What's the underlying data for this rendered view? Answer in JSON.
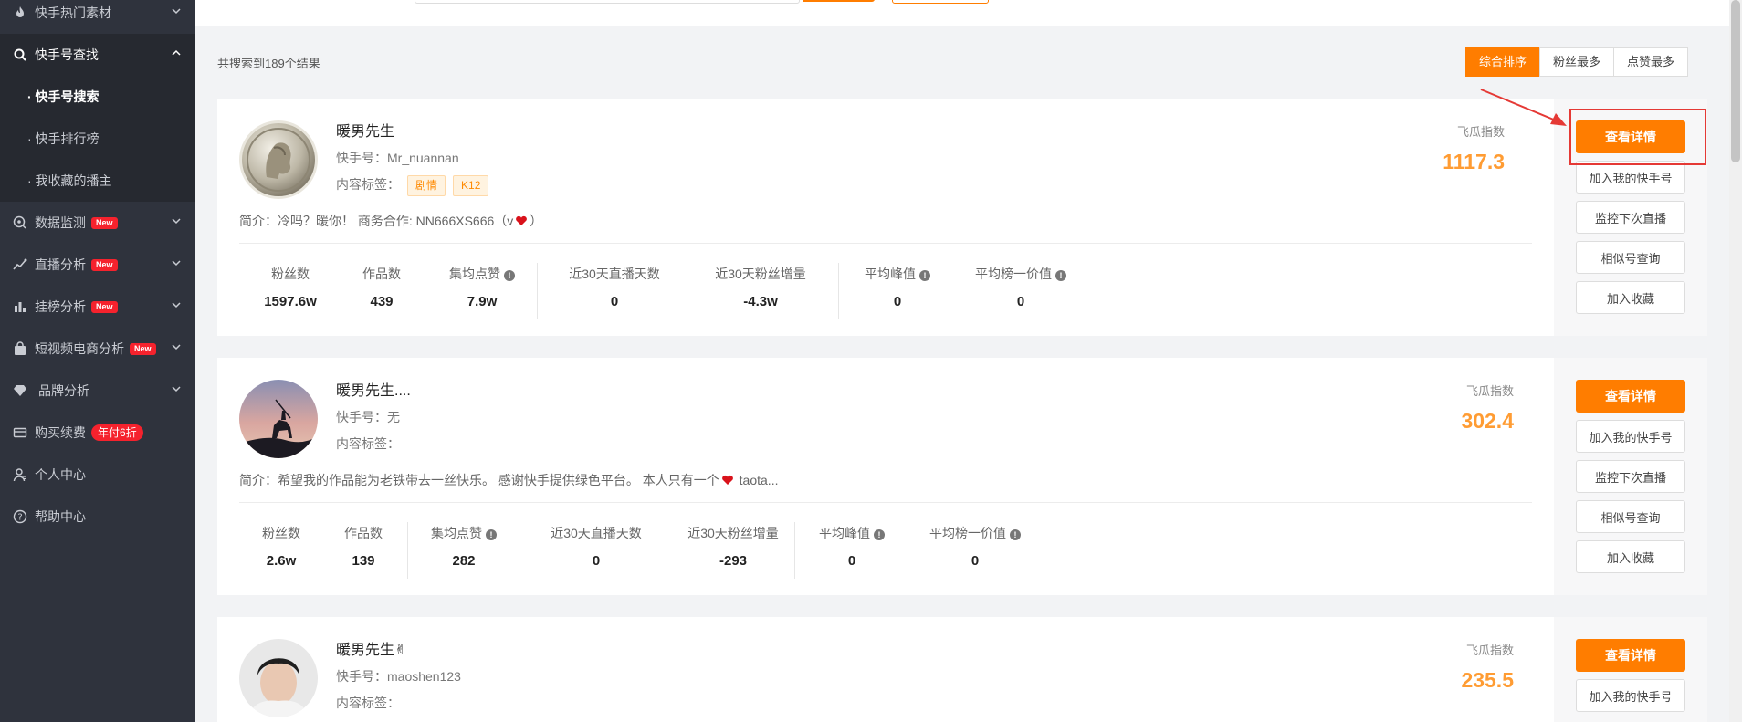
{
  "sidebar": {
    "items": [
      {
        "label": "快手热门素材",
        "icon": "fire-icon"
      },
      {
        "label": "快手号查找",
        "icon": "search-icon"
      },
      {
        "label": "· 快手号搜索"
      },
      {
        "label": "· 快手排行榜"
      },
      {
        "label": "· 我收藏的播主"
      },
      {
        "label": "数据监测",
        "icon": "monitor-icon",
        "badge": "New"
      },
      {
        "label": "直播分析",
        "icon": "trend-icon",
        "badge": "New"
      },
      {
        "label": "挂榜分析",
        "icon": "bar-chart-icon",
        "badge": "New"
      },
      {
        "label": "短视频电商分析",
        "icon": "shopping-bag-icon",
        "badge": "New"
      },
      {
        "label": "品牌分析",
        "icon": "diamond-icon"
      },
      {
        "label": "购买续费",
        "icon": "card-icon",
        "badge": "年付6折"
      },
      {
        "label": "个人中心",
        "icon": "user-icon"
      },
      {
        "label": "帮助中心",
        "icon": "help-icon"
      }
    ]
  },
  "results": {
    "count_text": "共搜索到189个结果",
    "sort_options": [
      "综合排序",
      "粉丝最多",
      "点赞最多"
    ],
    "active_sort": "综合排序"
  },
  "labels": {
    "ks_prefix": "快手号：",
    "tags_prefix": "内容标签：",
    "intro_prefix": "简介：",
    "index_label": "飞瓜指数"
  },
  "buttons": {
    "detail": "查看详情",
    "add_mine": "加入我的快手号",
    "monitor": "监控下次直播",
    "similar": "相似号查询",
    "favorite": "加入收藏"
  },
  "stat_labels": [
    "粉丝数",
    "作品数",
    "集均点赞",
    "近30天直播天数",
    "近30天粉丝增量",
    "平均峰值",
    "平均榜一价值"
  ],
  "cards": [
    {
      "name": "暖男先生",
      "ks_id": "Mr_nuannan",
      "tags": [
        "剧情",
        "K12"
      ],
      "intro_a": "冷吗？暖你！ 商务合作: NN666XS666（v",
      "intro_b": "）",
      "index": "1117.3",
      "stats": [
        "1597.6w",
        "439",
        "7.9w",
        "0",
        "-4.3w",
        "0",
        "0"
      ]
    },
    {
      "name": "暖男先生....",
      "ks_id": "无",
      "tags": [],
      "intro_a": "希望我的作品能为老铁带去一丝快乐。 感谢快手提供绿色平台。 本人只有一个",
      "intro_b": " taota...",
      "index": "302.4",
      "stats": [
        "2.6w",
        "139",
        "282",
        "0",
        "-293",
        "0",
        "0"
      ]
    },
    {
      "name": "暖男先生✌",
      "ks_id": "maoshen123",
      "tags": [],
      "index": "235.5"
    }
  ],
  "colors": {
    "accent": "#ff7d00",
    "index_value": "#ff9c33",
    "sidebar_bg": "#2f333d",
    "badge": "#f5222d",
    "highlight": "#e53935"
  }
}
